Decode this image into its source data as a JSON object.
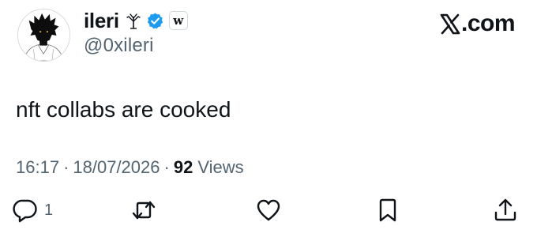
{
  "author": {
    "display_name": "ileri",
    "handle": "@0xileri",
    "name_emoji": "sprout-tree-icon",
    "verified": true,
    "affiliation_badge": "w"
  },
  "brand": {
    "logo": "x-logo-icon",
    "text": ".com"
  },
  "tweet": {
    "text": "nft collabs are cooked",
    "time": "16:17",
    "date": "18/07/2026",
    "separator": "·",
    "views_count": "92",
    "views_label": "Views"
  },
  "actions": {
    "reply_count": "1",
    "reply_icon": "reply-icon",
    "repost_icon": "repost-icon",
    "like_icon": "heart-icon",
    "bookmark_icon": "bookmark-icon",
    "share_icon": "share-icon"
  },
  "colors": {
    "text": "#0f1419",
    "secondary": "#536471",
    "verified": "#1d9bf0",
    "background": "#ffffff"
  }
}
